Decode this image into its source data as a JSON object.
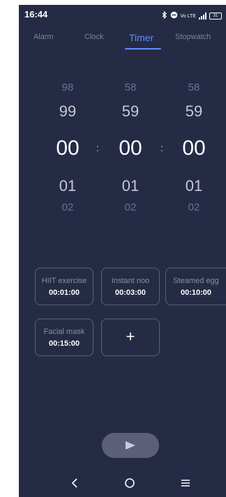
{
  "status_bar": {
    "time": "16:44",
    "icons": [
      "bluetooth-icon",
      "do-not-disturb-icon",
      "volte-icon",
      "signal-icon",
      "battery-icon"
    ],
    "volte_label": "Vo LTE",
    "battery_level": "31"
  },
  "tabs": [
    {
      "label": "Alarm",
      "active": false
    },
    {
      "label": "Clock",
      "active": false
    },
    {
      "label": "Timer",
      "active": true
    },
    {
      "label": "Stopwatch",
      "active": false
    }
  ],
  "picker": {
    "hours": {
      "far_above": "98",
      "above": "99",
      "selected": "00",
      "below": "01",
      "far_below": "02"
    },
    "minutes": {
      "far_above": "58",
      "above": "59",
      "selected": "00",
      "below": "01",
      "far_below": "02"
    },
    "seconds": {
      "far_above": "58",
      "above": "59",
      "selected": "00",
      "below": "01",
      "far_below": "02"
    },
    "separator": ":"
  },
  "presets": [
    {
      "name": "HIIT exercise",
      "time": "00:01:00"
    },
    {
      "name": "Instant noo",
      "time": "00:03:00"
    },
    {
      "name": "Steamed egg",
      "time": "00:10:00"
    },
    {
      "name": "Facial mask",
      "time": "00:15:00"
    }
  ],
  "add_preset_label": "+",
  "colors": {
    "background": "#262b45",
    "accent": "#5d8cff",
    "play_button": "#5b6078"
  }
}
